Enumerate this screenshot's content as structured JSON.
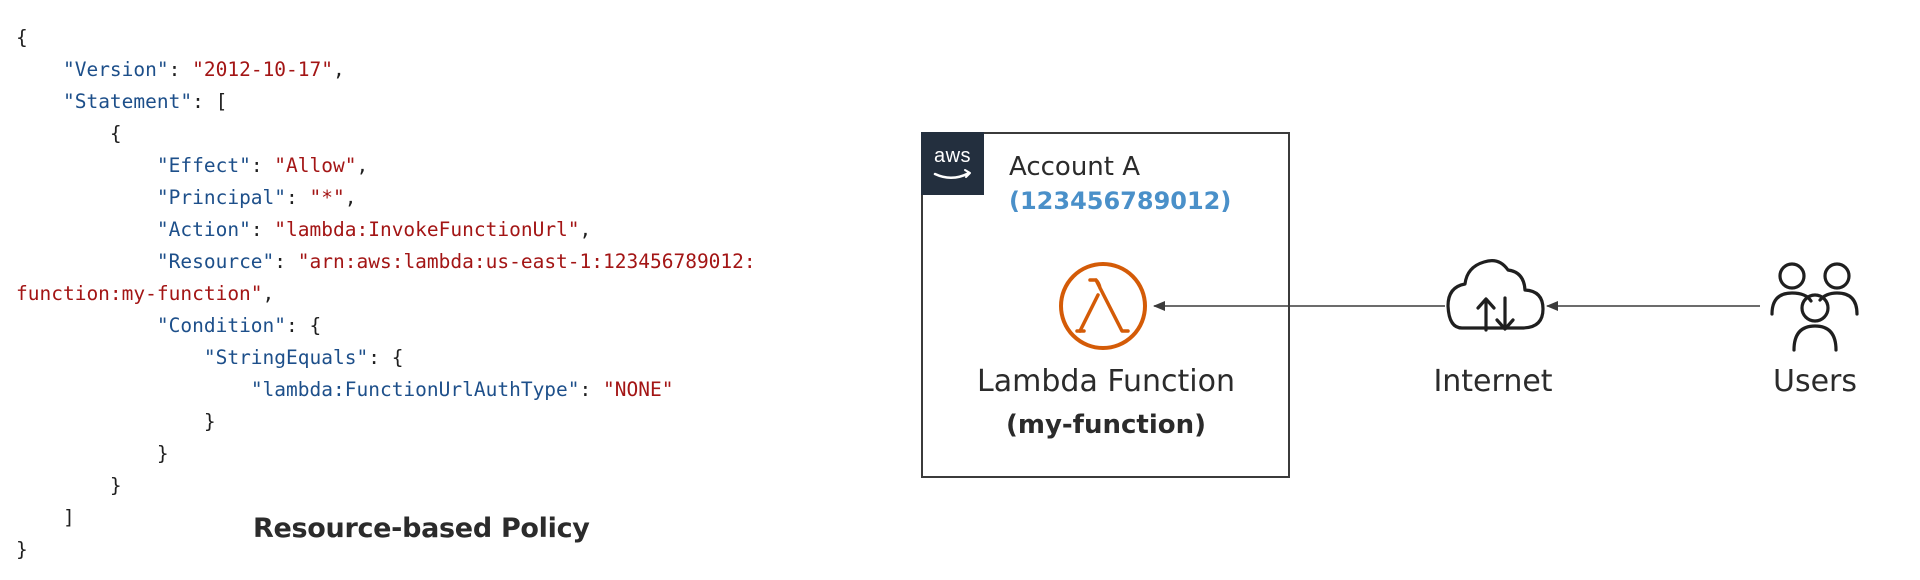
{
  "policy": {
    "caption": "Resource-based Policy",
    "lines": [
      [
        {
          "t": "{",
          "c": "p"
        }
      ],
      [
        {
          "t": "    ",
          "c": "p"
        },
        {
          "t": "\"Version\"",
          "c": "k"
        },
        {
          "t": ": ",
          "c": "p"
        },
        {
          "t": "\"2012-10-17\"",
          "c": "s"
        },
        {
          "t": ",",
          "c": "p"
        }
      ],
      [
        {
          "t": "    ",
          "c": "p"
        },
        {
          "t": "\"Statement\"",
          "c": "k"
        },
        {
          "t": ": [",
          "c": "p"
        }
      ],
      [
        {
          "t": "        {",
          "c": "p"
        }
      ],
      [
        {
          "t": "            ",
          "c": "p"
        },
        {
          "t": "\"Effect\"",
          "c": "k"
        },
        {
          "t": ": ",
          "c": "p"
        },
        {
          "t": "\"Allow\"",
          "c": "s"
        },
        {
          "t": ",",
          "c": "p"
        }
      ],
      [
        {
          "t": "            ",
          "c": "p"
        },
        {
          "t": "\"Principal\"",
          "c": "k"
        },
        {
          "t": ": ",
          "c": "p"
        },
        {
          "t": "\"*\"",
          "c": "s"
        },
        {
          "t": ",",
          "c": "p"
        }
      ],
      [
        {
          "t": "            ",
          "c": "p"
        },
        {
          "t": "\"Action\"",
          "c": "k"
        },
        {
          "t": ": ",
          "c": "p"
        },
        {
          "t": "\"lambda:InvokeFunctionUrl\"",
          "c": "s"
        },
        {
          "t": ",",
          "c": "p"
        }
      ],
      [
        {
          "t": "            ",
          "c": "p"
        },
        {
          "t": "\"Resource\"",
          "c": "k"
        },
        {
          "t": ": ",
          "c": "p"
        },
        {
          "t": "\"arn:aws:lambda:us-east-1:123456789012:",
          "c": "s"
        }
      ],
      [
        {
          "t": "function:my-function\"",
          "c": "s"
        },
        {
          "t": ",",
          "c": "p"
        }
      ],
      [
        {
          "t": "            ",
          "c": "p"
        },
        {
          "t": "\"Condition\"",
          "c": "k"
        },
        {
          "t": ": {",
          "c": "p"
        }
      ],
      [
        {
          "t": "                ",
          "c": "p"
        },
        {
          "t": "\"StringEquals\"",
          "c": "k"
        },
        {
          "t": ": {",
          "c": "p"
        }
      ],
      [
        {
          "t": "                    ",
          "c": "p"
        },
        {
          "t": "\"lambda:FunctionUrlAuthType\"",
          "c": "k"
        },
        {
          "t": ": ",
          "c": "p"
        },
        {
          "t": "\"NONE\"",
          "c": "s"
        }
      ],
      [
        {
          "t": "                }",
          "c": "p"
        }
      ],
      [
        {
          "t": "            }",
          "c": "p"
        }
      ],
      [
        {
          "t": "        }",
          "c": "p"
        }
      ],
      [
        {
          "t": "    ]",
          "c": "p"
        }
      ],
      [
        {
          "t": "}",
          "c": "p"
        }
      ]
    ]
  },
  "diagram": {
    "aws_logo_text": "aws",
    "account_name": "Account A",
    "account_id": "(123456789012)",
    "lambda_label": "Lambda Function",
    "lambda_sublabel": "(my-function)",
    "internet_label": "Internet",
    "users_label": "Users",
    "colors": {
      "lambda_orange": "#d45b07",
      "account_id_blue": "#4a90c9",
      "aws_logo_bg": "#232f3e",
      "json_key": "#1d4f8a",
      "json_string": "#a31515"
    },
    "icons": [
      "lambda-icon",
      "cloud-internet-icon",
      "users-icon",
      "aws-logo-icon"
    ]
  }
}
